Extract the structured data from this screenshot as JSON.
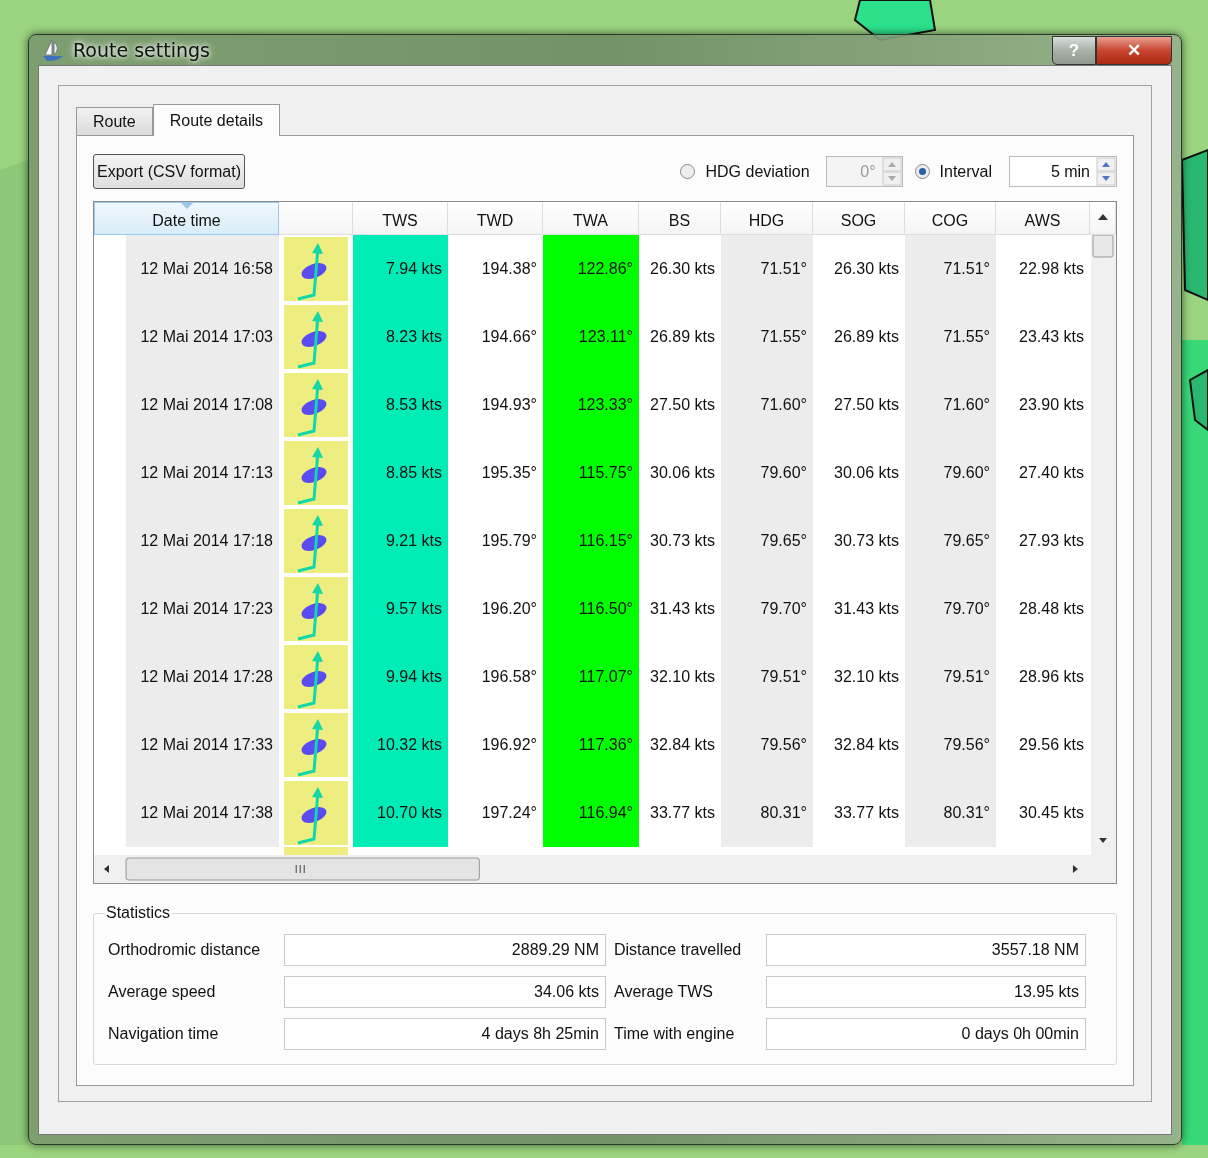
{
  "window": {
    "title": "Route settings",
    "help_button": "?",
    "close_button": "✕"
  },
  "tabs": [
    {
      "label": "Route",
      "selected": false
    },
    {
      "label": "Route details",
      "selected": true
    }
  ],
  "export_button": "Export (CSV format)",
  "options": [
    {
      "label": "HDG deviation",
      "selected": false,
      "value": "0°",
      "disabled": true
    },
    {
      "label": "Interval",
      "selected": true,
      "value": "5 min",
      "disabled": false
    }
  ],
  "table": {
    "columns": [
      {
        "label": "Date time",
        "sorted": true,
        "shaded": true
      },
      {
        "label": "TWS",
        "sorted": false,
        "color": "#00ecb6"
      },
      {
        "label": "TWD",
        "sorted": false,
        "shaded": false
      },
      {
        "label": "TWA",
        "sorted": false,
        "color": "#00ff00"
      },
      {
        "label": "BS",
        "sorted": false,
        "shaded": false
      },
      {
        "label": "HDG",
        "sorted": false,
        "shaded": true
      },
      {
        "label": "SOG",
        "sorted": false,
        "shaded": false
      },
      {
        "label": "COG",
        "sorted": false,
        "shaded": true
      },
      {
        "label": "AWS",
        "sorted": false,
        "shaded": false
      }
    ],
    "rows": [
      {
        "date_time": "12 Mai 2014 16:58",
        "values": [
          "7.94 kts",
          "194.38°",
          "122.86°",
          "26.30 kts",
          "71.51°",
          "26.30 kts",
          "71.51°",
          "22.98 kts"
        ]
      },
      {
        "date_time": "12 Mai 2014 17:03",
        "values": [
          "8.23 kts",
          "194.66°",
          "123.11°",
          "26.89 kts",
          "71.55°",
          "26.89 kts",
          "71.55°",
          "23.43 kts"
        ]
      },
      {
        "date_time": "12 Mai 2014 17:08",
        "values": [
          "8.53 kts",
          "194.93°",
          "123.33°",
          "27.50 kts",
          "71.60°",
          "27.50 kts",
          "71.60°",
          "23.90 kts"
        ]
      },
      {
        "date_time": "12 Mai 2014 17:13",
        "values": [
          "8.85 kts",
          "195.35°",
          "115.75°",
          "30.06 kts",
          "79.60°",
          "30.06 kts",
          "79.60°",
          "27.40 kts"
        ]
      },
      {
        "date_time": "12 Mai 2014 17:18",
        "values": [
          "9.21 kts",
          "195.79°",
          "116.15°",
          "30.73 kts",
          "79.65°",
          "30.73 kts",
          "79.65°",
          "27.93 kts"
        ]
      },
      {
        "date_time": "12 Mai 2014 17:23",
        "values": [
          "9.57 kts",
          "196.20°",
          "116.50°",
          "31.43 kts",
          "79.70°",
          "31.43 kts",
          "79.70°",
          "28.48 kts"
        ]
      },
      {
        "date_time": "12 Mai 2014 17:28",
        "values": [
          "9.94 kts",
          "196.58°",
          "117.07°",
          "32.10 kts",
          "79.51°",
          "32.10 kts",
          "79.51°",
          "28.96 kts"
        ]
      },
      {
        "date_time": "12 Mai 2014 17:33",
        "values": [
          "10.32 kts",
          "196.92°",
          "117.36°",
          "32.84 kts",
          "79.56°",
          "32.84 kts",
          "79.56°",
          "29.56 kts"
        ]
      },
      {
        "date_time": "12 Mai 2014 17:38",
        "values": [
          "10.70 kts",
          "197.24°",
          "116.94°",
          "33.77 kts",
          "80.31°",
          "33.77 kts",
          "80.31°",
          "30.45 kts"
        ]
      }
    ]
  },
  "statistics": {
    "title": "Statistics",
    "items": [
      {
        "label": "Orthodromic distance",
        "value": "2889.29 NM"
      },
      {
        "label": "Distance travelled",
        "value": "3557.18 NM"
      },
      {
        "label": "Average speed",
        "value": "34.06 kts"
      },
      {
        "label": "Average TWS",
        "value": "13.95 kts"
      },
      {
        "label": "Navigation time",
        "value": "4 days 8h 25min"
      },
      {
        "label": "Time with engine",
        "value": "0 days 0h 00min"
      }
    ]
  }
}
